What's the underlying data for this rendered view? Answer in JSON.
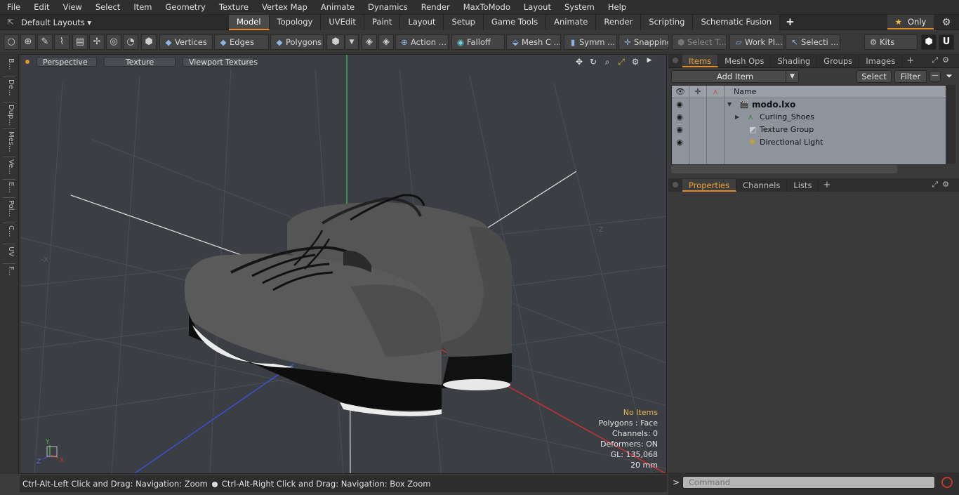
{
  "menu": [
    "File",
    "Edit",
    "View",
    "Select",
    "Item",
    "Geometry",
    "Texture",
    "Vertex Map",
    "Animate",
    "Dynamics",
    "Render",
    "MaxToModo",
    "Layout",
    "System",
    "Help"
  ],
  "layout": {
    "selector": "Default Layouts ▾",
    "tabs": [
      "Model",
      "Topology",
      "UVEdit",
      "Paint",
      "Layout",
      "Setup",
      "Game Tools",
      "Animate",
      "Render",
      "Scripting",
      "Schematic Fusion"
    ],
    "active_tab": "Model",
    "only_label": "Only"
  },
  "toolbar": {
    "vertices": "Vertices",
    "edges": "Edges",
    "polygons": "Polygons",
    "action": "Action",
    "falloff": "Falloff",
    "mesh": "Mesh C ...",
    "symm": "Symm ...",
    "snapping": "Snapping",
    "select_t": "Select T...",
    "work_pl": "Work Pl...",
    "selecti": "Selecti ...",
    "kits": "Kits"
  },
  "leftstrip": [
    "B...",
    "De...",
    "Dup...",
    "Mes...",
    "Ve...",
    "E...",
    "Pol...",
    "C...",
    "UV",
    "F..."
  ],
  "viewport": {
    "perspective": "Perspective",
    "texture": "Texture",
    "viewport_textures": "Viewport Textures",
    "info": {
      "no_items": "No Items",
      "polygons": "Polygons : Face",
      "channels": "Channels: 0",
      "deformers": "Deformers: ON",
      "gl": "GL: 135,068",
      "scale": "20 mm"
    },
    "axis_labels": {
      "x": "X",
      "y": "Y",
      "z": "Z",
      "neg_x": "-X",
      "neg_z": "-Z"
    }
  },
  "status": {
    "left": "Ctrl-Alt-Left Click and Drag: Navigation: Zoom",
    "right": "Ctrl-Alt-Right Click and Drag: Navigation: Box Zoom"
  },
  "items_panel": {
    "tabs": [
      "Items",
      "Mesh Ops",
      "Shading",
      "Groups",
      "Images"
    ],
    "active_tab": "Items",
    "add_item": "Add Item",
    "select": "Select",
    "filter": "Filter",
    "column_name": "Name",
    "tree": [
      {
        "label": "modo.lxo",
        "depth": 0,
        "icon": "scene-icon",
        "expanded": true
      },
      {
        "label": "Curling_Shoes",
        "depth": 1,
        "icon": "mesh-icon",
        "collapsed": true
      },
      {
        "label": "Texture Group",
        "depth": 1,
        "icon": "texture-group-icon"
      },
      {
        "label": "Directional Light",
        "depth": 1,
        "icon": "light-icon"
      }
    ]
  },
  "properties_panel": {
    "tabs": [
      "Properties",
      "Channels",
      "Lists"
    ],
    "active_tab": "Properties"
  },
  "command": {
    "prompt": ">",
    "placeholder": "Command"
  },
  "colors": {
    "accent": "#e28a2b",
    "viewport_bg": "#3b3f44",
    "axis_x": "#c83232",
    "axis_y": "#3fc24a",
    "axis_z": "#3d4fd6"
  }
}
